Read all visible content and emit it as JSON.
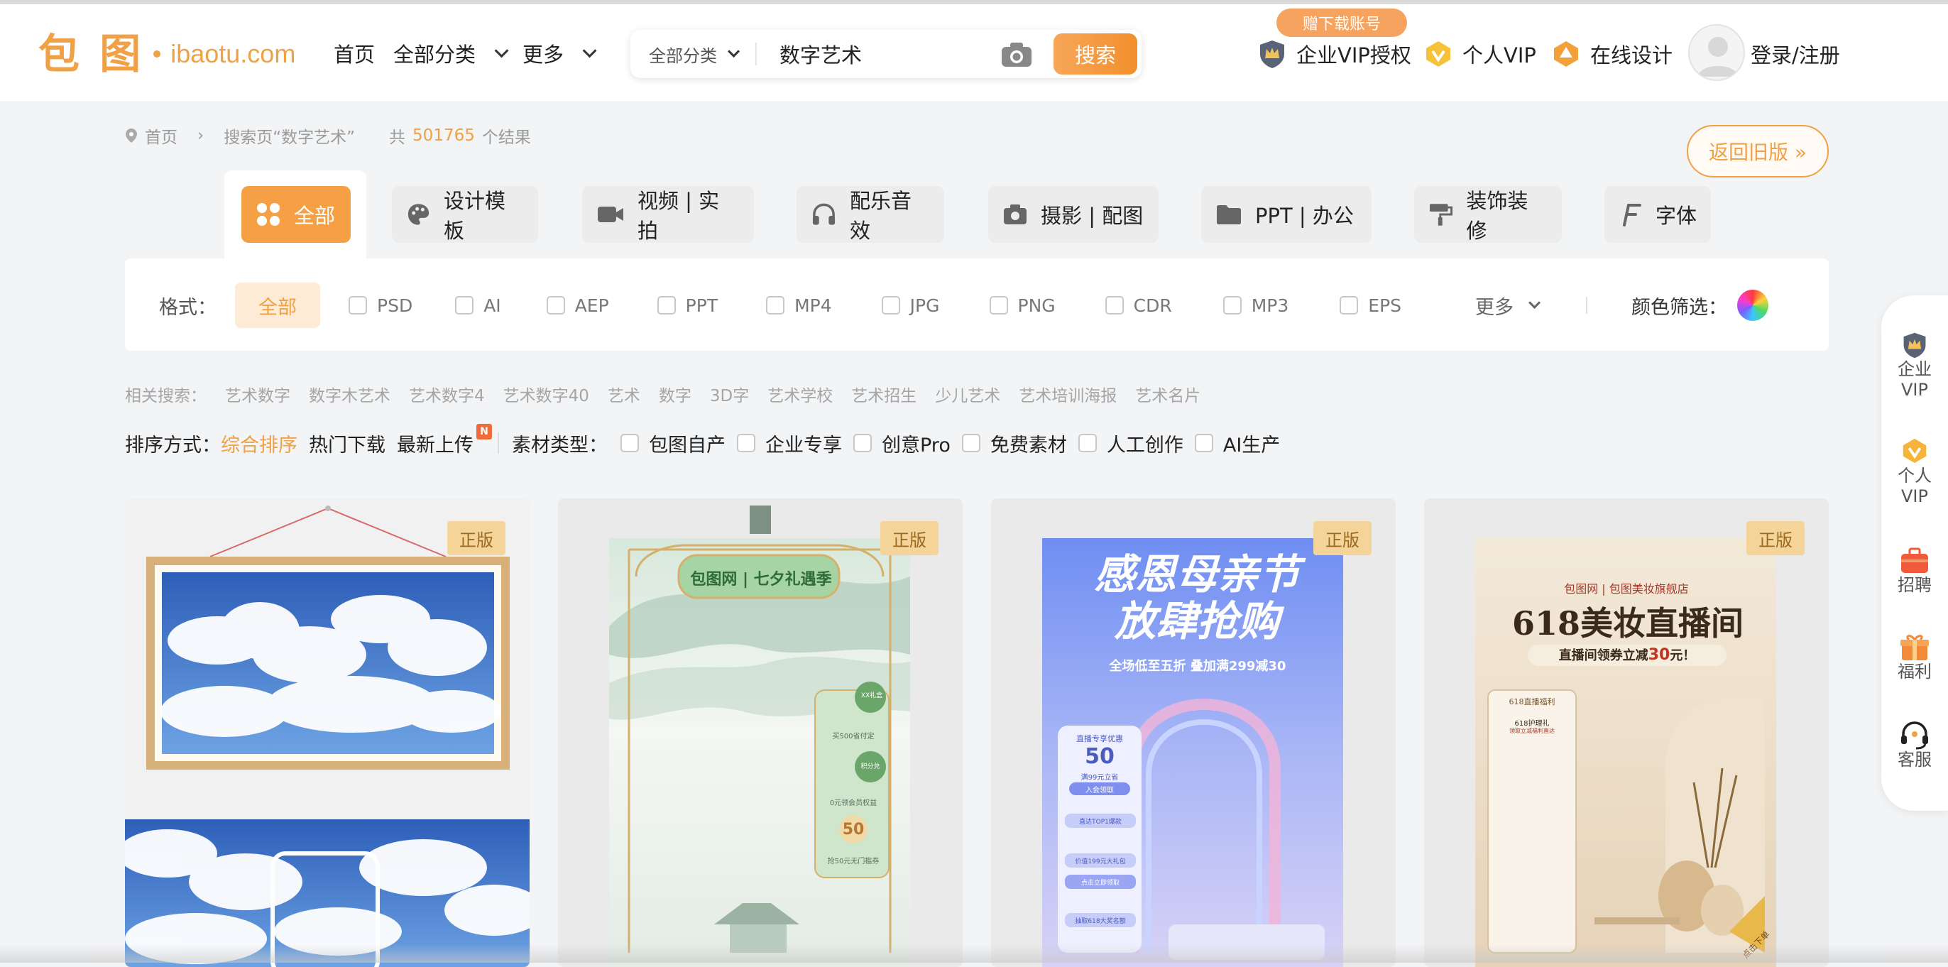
{
  "header": {
    "logo_mark": "包 图",
    "logo_domain": "ibaotu.com",
    "nav": [
      {
        "label": "首页"
      },
      {
        "label": "全部分类"
      },
      {
        "label": "更多"
      }
    ],
    "search": {
      "category": "全部分类",
      "query": "数字艺术",
      "button": "搜索"
    },
    "promo_badge": "赠下载账号",
    "links": [
      {
        "label": "企业VIP授权"
      },
      {
        "label": "个人VIP"
      },
      {
        "label": "在线设计"
      }
    ],
    "login": "登录/注册"
  },
  "breadcrumb": {
    "home": "首页",
    "search_page": "搜索页“数字艺术”",
    "count_prefix": "共",
    "count": "501765",
    "count_suffix": "个结果"
  },
  "old_version_button": "返回旧版 »",
  "tabs": [
    {
      "label": "全部",
      "icon": "grid-icon",
      "active": true
    },
    {
      "label": "设计模板",
      "icon": "palette-icon"
    },
    {
      "label": "视频 | 实拍",
      "icon": "video-icon"
    },
    {
      "label": "配乐音效",
      "icon": "headphones-icon"
    },
    {
      "label": "摄影 | 配图",
      "icon": "camera-icon"
    },
    {
      "label": "PPT | 办公",
      "icon": "folder-icon"
    },
    {
      "label": "装饰装修",
      "icon": "paint-roller-icon"
    },
    {
      "label": "字体",
      "icon": "font-icon"
    }
  ],
  "formats": {
    "label": "格式：",
    "all": "全部",
    "items": [
      "PSD",
      "AI",
      "AEP",
      "PPT",
      "MP4",
      "JPG",
      "PNG",
      "CDR",
      "MP3",
      "EPS"
    ],
    "more": "更多",
    "color_label": "颜色筛选："
  },
  "related": {
    "label": "相关搜索：",
    "items": [
      "艺术数字",
      "数字木艺术",
      "艺术数字4",
      "艺术数字40",
      "艺术",
      "数字",
      "3D字",
      "艺术学校",
      "艺术招生",
      "少儿艺术",
      "艺术培训海报",
      "艺术名片"
    ]
  },
  "sort": {
    "label": "排序方式：",
    "options": [
      "综合排序",
      "热门下载",
      "最新上传"
    ],
    "new_tag": "N",
    "type_label": "素材类型：",
    "types": [
      "包图自产",
      "企业专享",
      "创意Pro",
      "免费素材",
      "人工创作",
      "AI生产"
    ]
  },
  "cards": [
    {
      "badge": "正版"
    },
    {
      "badge": "正版",
      "poster_brand": "包图网 | 七夕礼遇季",
      "label_a": "XX礼盒",
      "label_b": "买500省付定",
      "label_c": "积分兑",
      "label_d": "0元领会员权益",
      "price": "50",
      "label_e": "抢50元无门槛券"
    },
    {
      "badge": "正版",
      "headline1": "感恩母亲节",
      "headline2": "放肆抢购",
      "subline": "全场低至五折 叠加满299减30",
      "panel_title": "直播专享优惠",
      "panel_price": "50",
      "panel_sub": "满99元立省",
      "panel_btn": "入会领取",
      "panel_rows": [
        "直达TOP1爆款",
        "价值199元大礼包",
        "点击立即领取",
        "抽取618大奖名额"
      ]
    },
    {
      "badge": "正版",
      "brand": "包图网 | 包图美妆旗舰店",
      "title": "618美妆直播间",
      "subtitle_pre": "直播间领券立减",
      "subtitle_num": "30",
      "subtitle_post": "元！",
      "list_title": "618直播福利",
      "list_head": "618护理礼",
      "list_sub": "领取立减福利直达",
      "ribbon": "点击下单"
    }
  ],
  "sidebar": [
    {
      "label": "企业\nVIP",
      "icon": "crown-shield-icon"
    },
    {
      "label": "个人\nVIP",
      "icon": "vip-badge-icon"
    },
    {
      "label": "招聘",
      "icon": "briefcase-icon"
    },
    {
      "label": "福利",
      "icon": "gift-icon"
    },
    {
      "label": "客服",
      "icon": "headset-icon"
    }
  ]
}
